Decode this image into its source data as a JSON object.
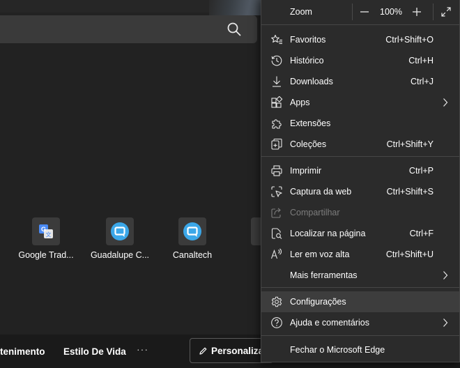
{
  "search": {
    "icon": "search-icon"
  },
  "tiles": [
    {
      "label": "Google Trad...",
      "icon": "google-translate-icon"
    },
    {
      "label": "Guadalupe C...",
      "icon": "chat-bubble-icon"
    },
    {
      "label": "Canaltech",
      "icon": "chat-bubble-icon"
    }
  ],
  "bottom_bar": {
    "link1": "tenimento",
    "link2": "Estilo De Vida",
    "more": "···",
    "personalize_label": "Personalizar"
  },
  "menu": {
    "zoom": {
      "label": "Zoom",
      "value": "100%"
    },
    "items": [
      {
        "label": "Favoritos",
        "shortcut": "Ctrl+Shift+O",
        "icon": "star-icon"
      },
      {
        "label": "Histórico",
        "shortcut": "Ctrl+H",
        "icon": "history-icon"
      },
      {
        "label": "Downloads",
        "shortcut": "Ctrl+J",
        "icon": "download-icon"
      },
      {
        "label": "Apps",
        "shortcut": "",
        "icon": "apps-icon"
      },
      {
        "label": "Extensões",
        "shortcut": "",
        "icon": "extensions-icon"
      },
      {
        "label": "Coleções",
        "shortcut": "Ctrl+Shift+Y",
        "icon": "collections-icon"
      },
      {
        "label": "Imprimir",
        "shortcut": "Ctrl+P",
        "icon": "printer-icon"
      },
      {
        "label": "Captura da web",
        "shortcut": "Ctrl+Shift+S",
        "icon": "web-capture-icon"
      },
      {
        "label": "Compartilhar",
        "shortcut": "",
        "icon": "share-icon"
      },
      {
        "label": "Localizar na página",
        "shortcut": "Ctrl+F",
        "icon": "find-icon"
      },
      {
        "label": "Ler em voz alta",
        "shortcut": "Ctrl+Shift+U",
        "icon": "read-aloud-icon"
      },
      {
        "label": "Mais ferramentas",
        "shortcut": "",
        "icon": ""
      },
      {
        "label": "Configurações",
        "shortcut": "",
        "icon": "gear-icon"
      },
      {
        "label": "Ajuda e comentários",
        "shortcut": "",
        "icon": "help-icon"
      },
      {
        "label": "Fechar o Microsoft Edge",
        "shortcut": "",
        "icon": ""
      }
    ]
  },
  "colors": {
    "menu_bg": "#2b2b2b",
    "hover_bg": "#3d3d3d",
    "disabled_text": "#7d7d7d",
    "accent_blue": "#3ba7e8"
  }
}
